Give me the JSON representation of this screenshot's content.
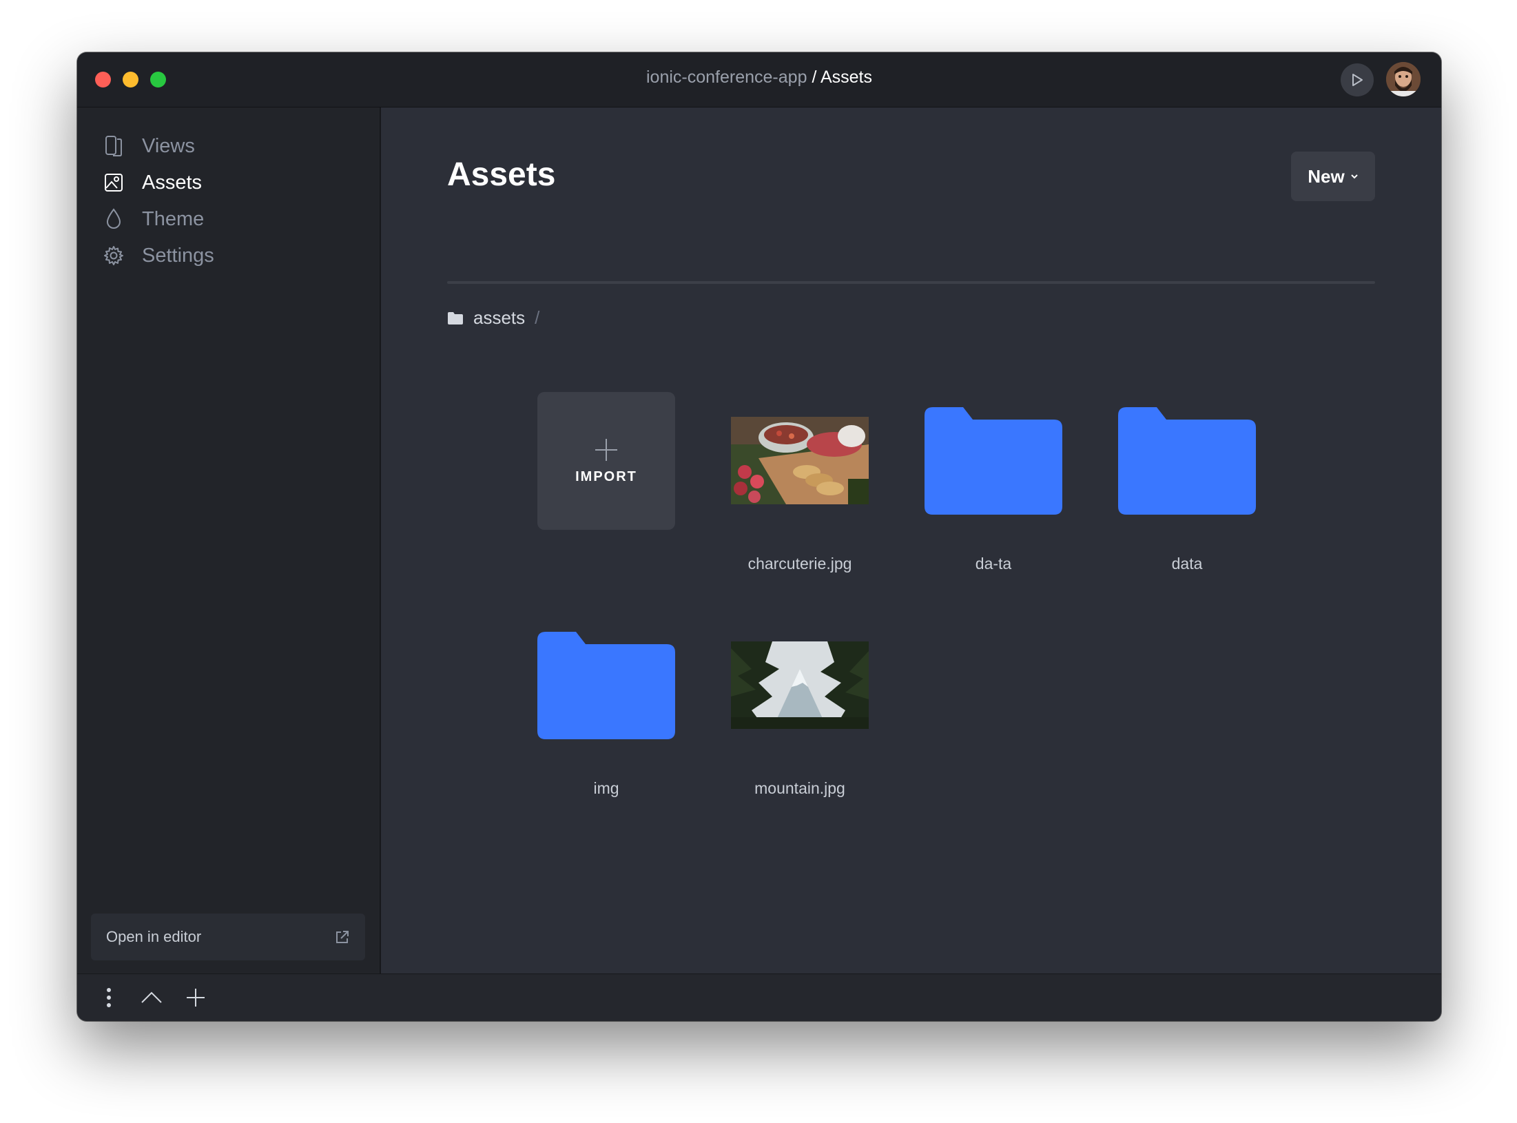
{
  "titlebar": {
    "project": "ionic-conference-app",
    "separator": "/",
    "current": "Assets"
  },
  "sidebar": {
    "items": [
      {
        "label": "Views",
        "icon": "views-icon",
        "active": false
      },
      {
        "label": "Assets",
        "icon": "image-icon",
        "active": true
      },
      {
        "label": "Theme",
        "icon": "drop-icon",
        "active": false
      },
      {
        "label": "Settings",
        "icon": "gear-icon",
        "active": false
      }
    ],
    "open_editor_label": "Open in editor"
  },
  "main": {
    "title": "Assets",
    "new_button_label": "New",
    "breadcrumb": {
      "folder": "assets",
      "separator": "/"
    },
    "import_label": "IMPORT",
    "files": [
      {
        "name": "charcuterie.jpg",
        "type": "image"
      },
      {
        "name": "da-ta",
        "type": "folder"
      },
      {
        "name": "data",
        "type": "folder"
      },
      {
        "name": "img",
        "type": "folder"
      },
      {
        "name": "mountain.jpg",
        "type": "image"
      }
    ]
  },
  "colors": {
    "folder": "#3a77ff",
    "accent_text": "#ffffff",
    "muted_text": "#8c93a1",
    "window_bg": "#2c2f38",
    "sidebar_bg": "#222429"
  }
}
